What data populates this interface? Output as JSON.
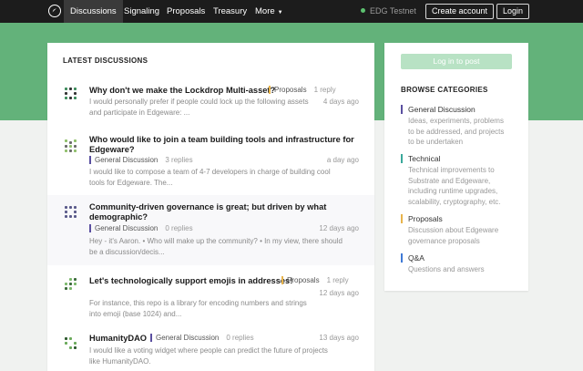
{
  "nav": {
    "tabs": [
      "Discussions",
      "Signaling",
      "Proposals",
      "Treasury",
      "More"
    ],
    "network": "EDG Testnet",
    "create_account": "Create account",
    "login": "Login"
  },
  "main": {
    "section_title": "LATEST DISCUSSIONS",
    "threads": [
      {
        "title": "Why don't we make the Lockdrop Multi-asset?",
        "category": "Proposals",
        "replies": "1 reply",
        "date": "4 days ago",
        "excerpt": [
          "I would personally prefer if people could lock up the following assets",
          "and participate in Edgeware: ..."
        ]
      },
      {
        "title": [
          "Who would like to join a team building tools and infrastructure for",
          "Edgeware?"
        ],
        "category": "General Discussion",
        "replies": "3 replies",
        "date": "a day ago",
        "excerpt": [
          "I would like to compose a team of 4-7 developers in charge of building cool",
          "tools for Edgeware. The..."
        ]
      },
      {
        "title": [
          "Community-driven governance is great; but driven by what",
          "demographic?"
        ],
        "category": "General Discussion",
        "replies": "0 replies",
        "date": "12 days ago",
        "excerpt": [
          "Hey - it's Aaron. • Who will make up the community? • In my view, there should",
          "be a discussion/decis..."
        ]
      },
      {
        "title": "Let's technologically support emojis in addresses!",
        "category": "Proposals",
        "replies": "1 reply",
        "date": "12 days ago",
        "excerpt": [
          "For instance, this repo is a library for encoding numbers and strings",
          "into emoji (base 1024) and..."
        ]
      },
      {
        "title": "HumanityDAO",
        "category": "General Discussion",
        "replies": "0 replies",
        "date": "13 days ago",
        "excerpt": [
          "I would like a voting widget where people can predict the future of projects",
          "like HumanityDAO."
        ]
      }
    ]
  },
  "sidebar": {
    "login_button": "Log in to post",
    "section_title": "BROWSE CATEGORIES",
    "categories": [
      {
        "name": "General Discussion",
        "desc": [
          "Ideas, experiments, problems",
          "to be addressed, and projects",
          "to be undertaken"
        ]
      },
      {
        "name": "Technical",
        "desc": [
          "Technical improvements to",
          "Substrate and Edgeware,",
          "including runtime upgrades,",
          "scalability, cryptography, etc."
        ]
      },
      {
        "name": "Proposals",
        "desc": [
          "Discussion about Edgeware",
          "governance proposals"
        ]
      },
      {
        "name": "Q&A",
        "desc": [
          "Questions and answers"
        ]
      }
    ]
  },
  "colors": {
    "banner": "#63b27a",
    "topbar": "#1c1c1c",
    "tag_general": "#5a4fa0",
    "tag_proposals": "#e8b44c",
    "tag_technical": "#3aa89a",
    "tag_qa": "#3f7ad6",
    "network_dot": "#5cc16f"
  },
  "icons": {
    "logo": "compass-logo-icon",
    "thread_avatar": "identicon-icon"
  }
}
